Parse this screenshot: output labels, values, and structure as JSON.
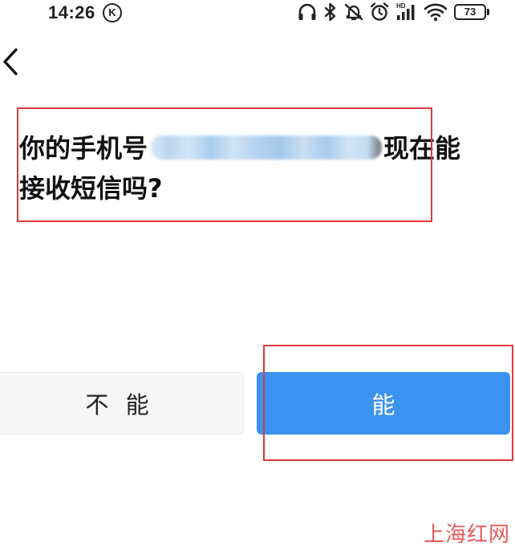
{
  "status_bar": {
    "time": "14:26",
    "k_badge": "K",
    "icons": [
      "headphones-icon",
      "bluetooth-icon",
      "mute-icon",
      "alarm-icon",
      "hd-signal-icon",
      "wifi-icon"
    ],
    "battery": "73"
  },
  "question": {
    "line1_start": "你的手机号",
    "phone_number_redacted": true,
    "line1_end": "现在能",
    "line2": "接收短信吗?"
  },
  "buttons": {
    "no_label": "不 能",
    "yes_label": "能"
  },
  "colors": {
    "primary_button": "#3b93ef",
    "secondary_button": "#f6f6f6",
    "annotation": "#e03a3a",
    "watermark": "#e55a5a"
  },
  "watermark": "上海红网"
}
